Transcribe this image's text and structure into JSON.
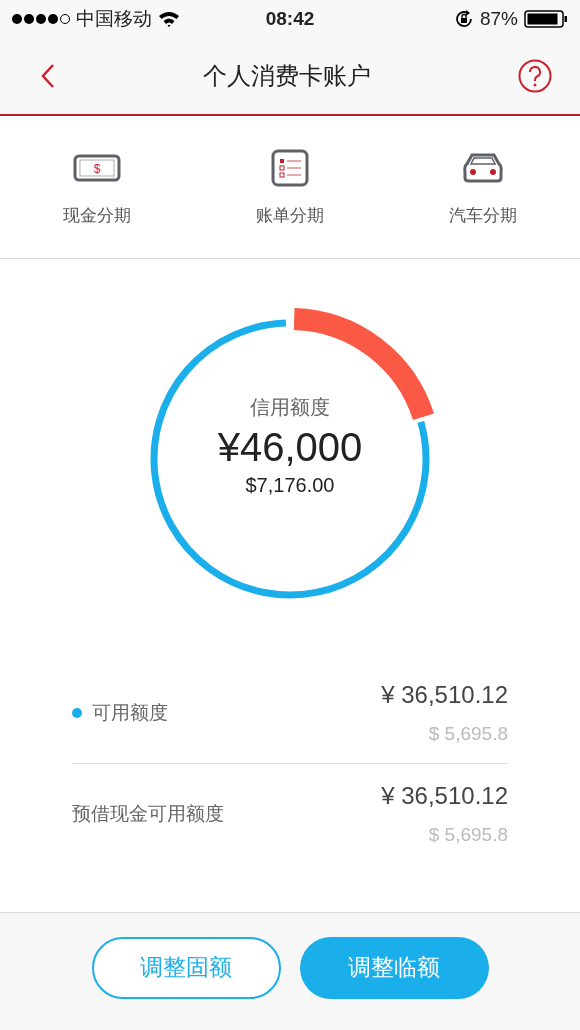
{
  "status_bar": {
    "carrier": "中国移动",
    "time": "08:42",
    "battery": "87%"
  },
  "nav": {
    "title": "个人消费卡账户"
  },
  "shortcuts": [
    {
      "kind": "cash",
      "icon_text": "$",
      "label": "现金分期"
    },
    {
      "kind": "bill",
      "label": "账单分期"
    },
    {
      "kind": "car",
      "label": "汽车分期"
    }
  ],
  "gauge": {
    "label": "信用额度",
    "amount": "¥46,000",
    "amount_usd": "$7,176.00"
  },
  "details": [
    {
      "label": "可用额度",
      "color": "#1aaeea",
      "amount": "¥ 36,510.12",
      "amount_usd": "$ 5,695.8"
    },
    {
      "label": "预借现金可用额度",
      "amount": "¥ 36,510.12",
      "amount_usd": "$ 5,695.8"
    }
  ],
  "buttons": [
    {
      "label": "调整固额",
      "kind": "outline"
    },
    {
      "label": "调整临额",
      "kind": "filled"
    }
  ]
}
